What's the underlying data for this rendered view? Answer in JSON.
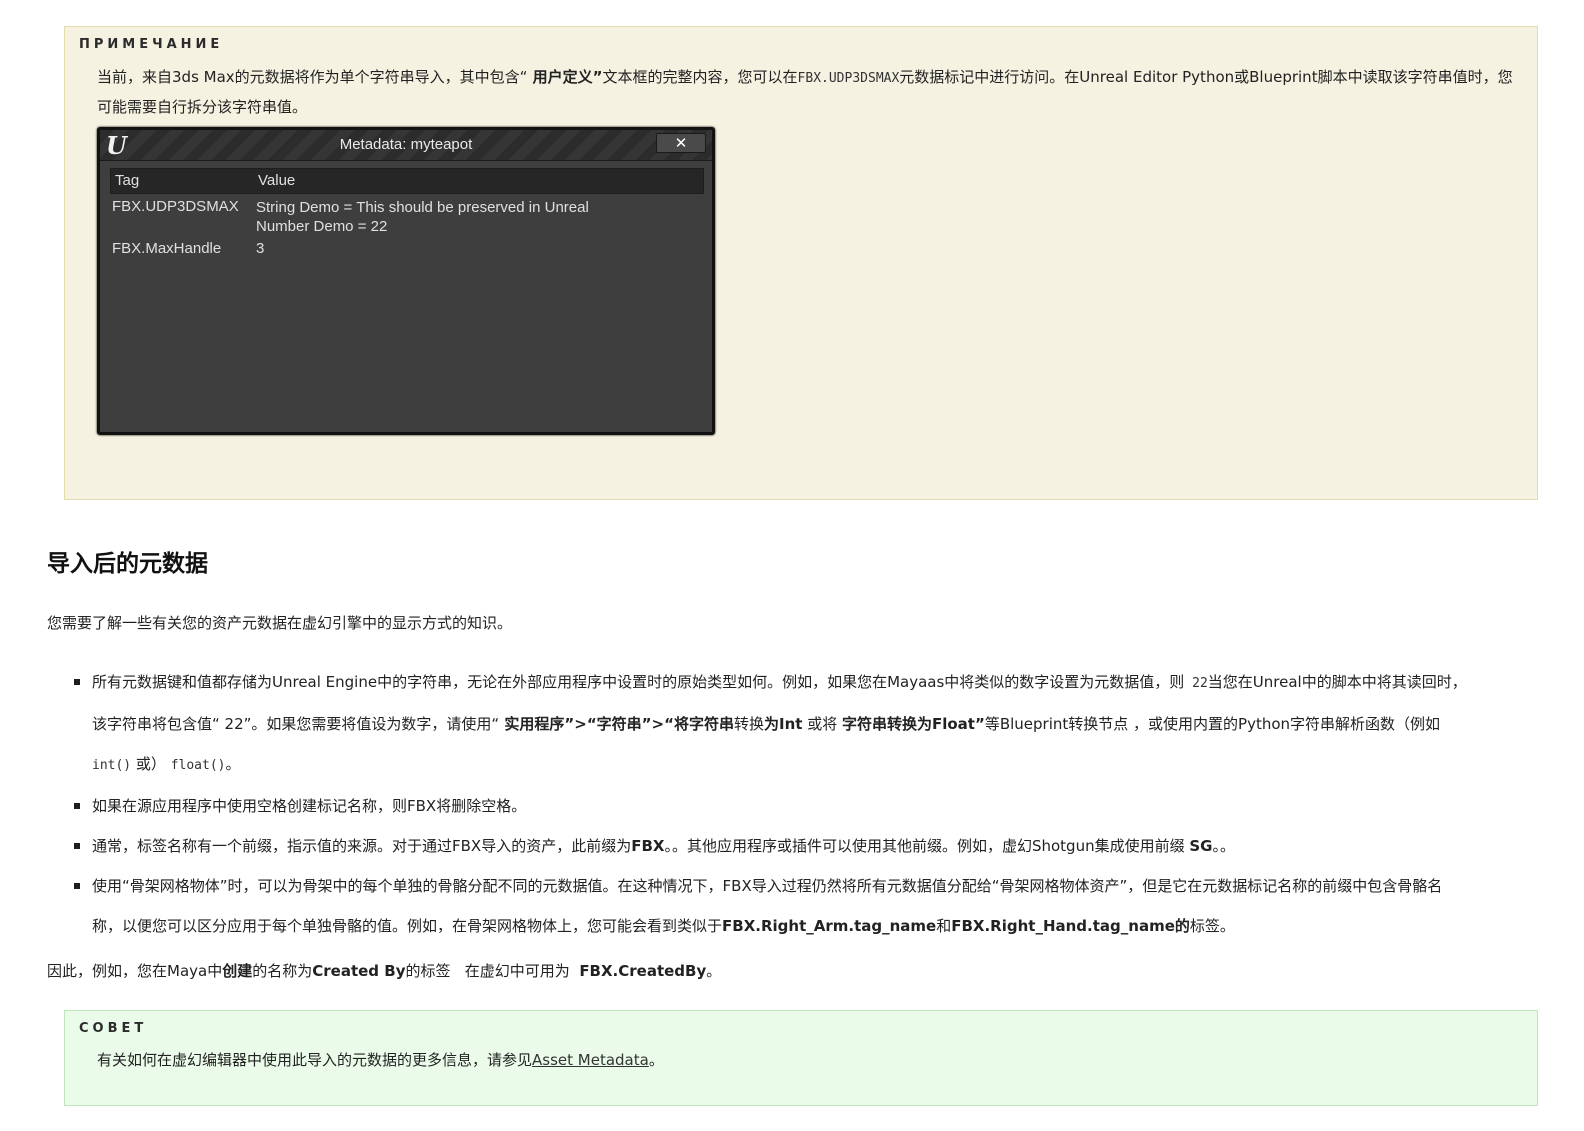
{
  "note": {
    "heading": "ПРИМЕЧАНИЕ",
    "text_1": "当前，来自3ds Max的元数据将作为单个字符串导入，其中包含“",
    "text_bold": " 用户定义”",
    "text_2": "文本框的完整内容，您可以在",
    "code": "FBX.UDP3DSMAX",
    "text_3": "元数据标记中进行访问。在Unreal Editor Python或Blueprint脚本中读取该字符串值时，您可能需要自行拆分该字符串值。"
  },
  "dialog": {
    "logo": "U",
    "title": "Metadata: myteapot",
    "close": "✕",
    "columns": {
      "tag": "Tag",
      "value": "Value"
    },
    "rows": [
      {
        "tag": "FBX.UDP3DSMAX",
        "value_line1": "String Demo = This should be preserved in Unreal",
        "value_line2": "Number Demo = 22"
      },
      {
        "tag": "FBX.MaxHandle",
        "value_line1": "3"
      }
    ]
  },
  "section": {
    "title": "导入后的元数据",
    "intro": "您需要了解一些有关您的资产元数据在虚幻引擎中的显示方式的知识。"
  },
  "bullets": {
    "b1_a": "所有元数据键和值都存储为Unreal Engine中的字符串，无论在外部应用程序中设置时的原始类型如何。例如，如果您在Mayaas中将类似的数字设置为元数据值，则",
    "b1_code1": " 22",
    "b1_b": "当您在Unreal中的脚本中将其读回时，",
    "b1_c": "该字符串将包含值“ 22”。如果您需要将值设为数字，请使用“",
    "b1_bold1": " 实用程序”>“字符串”>“将字符串",
    "b1_d": "转换",
    "b1_bold2": "为Int",
    "b1_e": " 或将 ",
    "b1_bold3": "字符串转换为Float”",
    "b1_f": "等Blueprint转换节点 ，或使用内置的Python字符串解析函数（例如",
    "b1_code2": "int()",
    "b1_g": " 或）",
    "b1_code3": "float()",
    "b1_h": "。",
    "b2": "如果在源应用程序中使用空格创建标记名称，则FBX将删除空格。",
    "b3_a": "通常，标签名称有一个前缀，指示值的来源。对于通过FBX导入的资产，此前缀为",
    "b3_bold1": "FBX",
    "b3_b": "。。其他应用程序或插件可以使用其他前缀。例如，虚幻Shotgun集成使用前缀 ",
    "b3_bold2": "SG",
    "b3_c": "。。",
    "b4_a": "使用“骨架网格物体”时，可以为骨架中的每个单独的骨骼分配不同的元数据值。在这种情况下，FBX导入过程仍然将所有元数据值分配给“骨架网格物体资产”，但是它在元数据标记名称的前缀中包含骨骼名",
    "b4_b": "称，以便您可以区分应用于每个单独骨骼的值。例如，在骨架网格物体上，您可能会看到类似于",
    "b4_bold1": "FBX.Right_Arm.tag_name",
    "b4_c": "和",
    "b4_bold2": "FBX.Right_Hand.tag_name的",
    "b4_d": "标签。"
  },
  "outro": {
    "a": "因此，例如，您在Maya中",
    "bold1": "创建",
    "b": "的名称为",
    "bold2": "Created By",
    "c": "的标签   在虚幻中可用为  ",
    "bold3": "FBX.CreatedBy",
    "d": "。"
  },
  "tip": {
    "heading": "СОВЕТ",
    "text": "有关如何在虚幻编辑器中使用此导入的元数据的更多信息，请参见",
    "link": "Asset Metadata",
    "end": "。"
  }
}
